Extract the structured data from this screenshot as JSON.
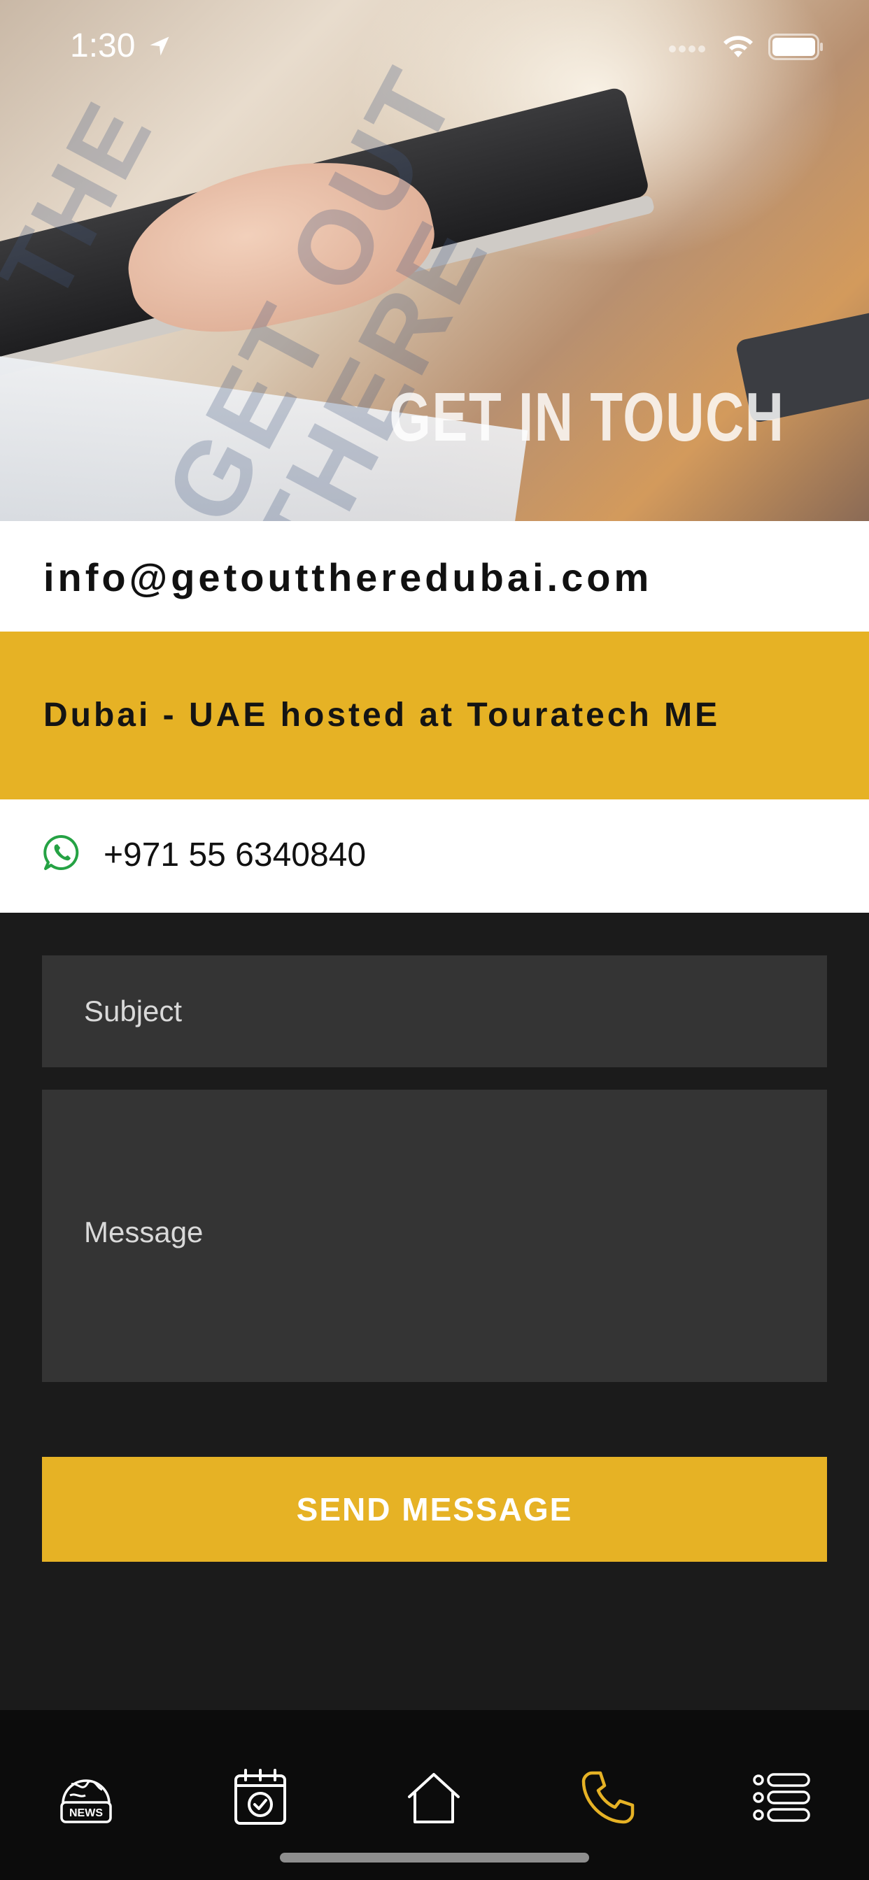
{
  "status_bar": {
    "time": "1:30",
    "icons": [
      "location-arrow-icon",
      "signal-icon",
      "wifi-icon",
      "battery-icon"
    ]
  },
  "hero": {
    "title": "GET IN TOUCH",
    "watermark_text": "GET OUT THERE"
  },
  "contact": {
    "email": "info@getouttheredubai.com",
    "address": "Dubai - UAE hosted at Touratech ME",
    "phone": "+971 55 6340840",
    "phone_icon": "whatsapp-icon"
  },
  "form": {
    "subject_placeholder": "Subject",
    "message_placeholder": "Message",
    "send_label": "SEND MESSAGE"
  },
  "tab_bar": {
    "items": [
      {
        "icon": "news-globe-icon",
        "label": "NEWS"
      },
      {
        "icon": "calendar-check-icon"
      },
      {
        "icon": "home-icon"
      },
      {
        "icon": "phone-icon",
        "active": true
      },
      {
        "icon": "menu-list-icon"
      }
    ]
  },
  "colors": {
    "accent": "#e6b225",
    "form_background": "#1b1b1b",
    "field_background": "#343434",
    "tab_bar_background": "#0c0c0c",
    "whatsapp": "#25a244"
  }
}
